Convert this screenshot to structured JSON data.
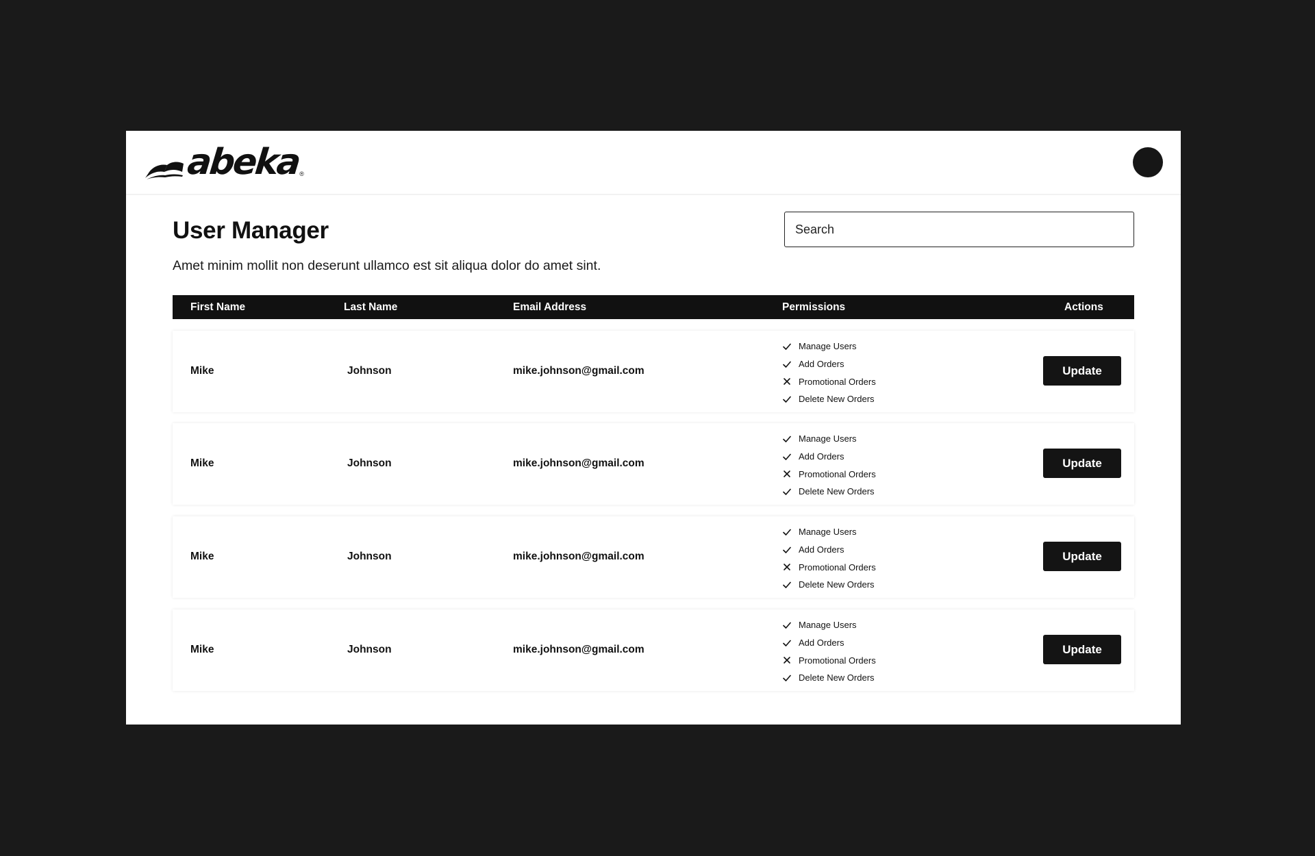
{
  "header": {
    "logo_text": "abeka",
    "logo_reg": "®"
  },
  "page": {
    "title": "User Manager",
    "description": "Amet minim mollit non deserunt ullamco est sit aliqua dolor do amet sint."
  },
  "search": {
    "placeholder": "Search"
  },
  "table": {
    "columns": {
      "first_name": "First Name",
      "last_name": "Last Name",
      "email": "Email Address",
      "permissions": "Permissions",
      "actions": "Actions"
    },
    "rows": [
      {
        "first_name": "Mike",
        "last_name": "Johnson",
        "email": "mike.johnson@gmail.com",
        "permissions": [
          {
            "label": "Manage Users",
            "granted": true
          },
          {
            "label": "Add Orders",
            "granted": true
          },
          {
            "label": "Promotional Orders",
            "granted": false
          },
          {
            "label": "Delete New Orders",
            "granted": true
          }
        ],
        "action_label": "Update"
      },
      {
        "first_name": "Mike",
        "last_name": "Johnson",
        "email": "mike.johnson@gmail.com",
        "permissions": [
          {
            "label": "Manage Users",
            "granted": true
          },
          {
            "label": "Add Orders",
            "granted": true
          },
          {
            "label": "Promotional Orders",
            "granted": false
          },
          {
            "label": "Delete New Orders",
            "granted": true
          }
        ],
        "action_label": "Update"
      },
      {
        "first_name": "Mike",
        "last_name": "Johnson",
        "email": "mike.johnson@gmail.com",
        "permissions": [
          {
            "label": "Manage Users",
            "granted": true
          },
          {
            "label": "Add Orders",
            "granted": true
          },
          {
            "label": "Promotional Orders",
            "granted": false
          },
          {
            "label": "Delete New Orders",
            "granted": true
          }
        ],
        "action_label": "Update"
      },
      {
        "first_name": "Mike",
        "last_name": "Johnson",
        "email": "mike.johnson@gmail.com",
        "permissions": [
          {
            "label": "Manage Users",
            "granted": true
          },
          {
            "label": "Add Orders",
            "granted": true
          },
          {
            "label": "Promotional Orders",
            "granted": false
          },
          {
            "label": "Delete New Orders",
            "granted": true
          }
        ],
        "action_label": "Update"
      }
    ]
  },
  "icons": {
    "granted": "check-icon",
    "denied": "cross-icon",
    "logo": "book-icon"
  },
  "colors": {
    "background": "#1a1a1a",
    "surface": "#ffffff",
    "primary": "#141414"
  }
}
